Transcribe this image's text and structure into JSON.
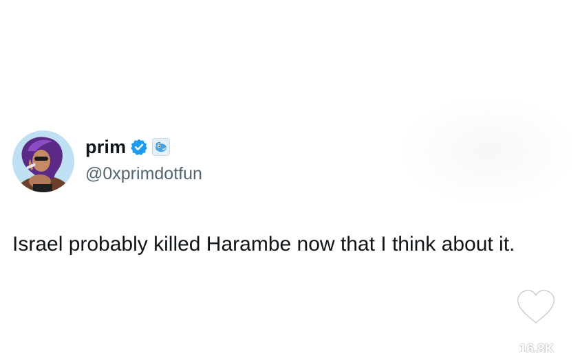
{
  "author": {
    "display_name": "prim",
    "handle": "@0xprimdotfun",
    "avatar_icon": "profile-photo",
    "verified_icon": "verified-badge-icon",
    "affiliate_icon": "affiliate-badge-icon"
  },
  "post": {
    "text": "Israel probably killed Harambe now that I think about it."
  },
  "actions": {
    "like_icon": "heart-icon",
    "like_count": "16.8K"
  },
  "colors": {
    "verified": "#1d9bf0",
    "text": "#0f1419",
    "secondary_text": "#536471"
  }
}
